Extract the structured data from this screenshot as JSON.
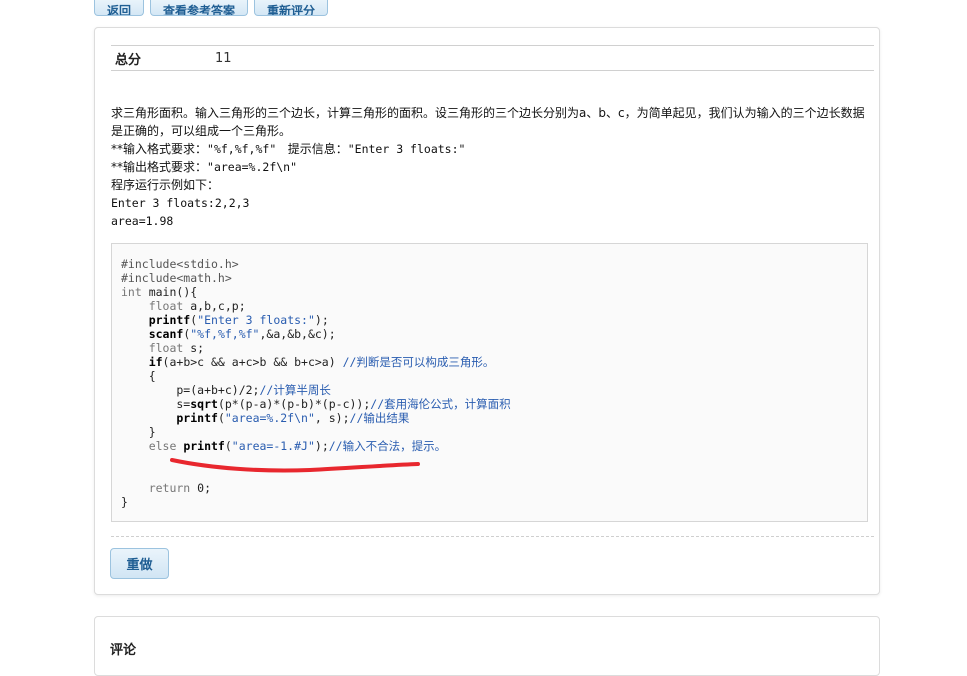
{
  "toolbar": {
    "back_label": "返回",
    "view_answer_label": "查看参考答案",
    "rescore_label": "重新评分"
  },
  "score": {
    "label": "总分",
    "value": "11"
  },
  "problem": {
    "line1": "求三角形面积。输入三角形的三个边长，计算三角形的面积。设三角形的三个边长分别为a、b、c，为简单起见，我们认为输入的三个边长数据是正确的，可以组成一个三角形。",
    "input_req_prefix": "**输入格式要求：",
    "input_req_format": "\"%f,%f,%f\"",
    "input_req_hint_label": "提示信息：",
    "input_req_hint": "\"Enter 3 floats:\"",
    "output_req_prefix": "**输出格式要求：",
    "output_req_format": "\"area=%.2f\\n\"",
    "example_label": "程序运行示例如下：",
    "example_input": "Enter 3 floats:2,2,3",
    "example_output": "area=1.98"
  },
  "code": {
    "l1": "#include<stdio.h>",
    "l2": "#include<math.h>",
    "l3a": "int",
    "l3b": " main(){",
    "l4a": "    float",
    "l4b": " a,b,c,p;",
    "l5a": "    printf",
    "l5b": "(",
    "l5c": "\"Enter 3 floats:\"",
    "l5d": ");",
    "l6a": "    scanf",
    "l6b": "(",
    "l6c": "\"%f,%f,%f\"",
    "l6d": ",&a,&b,&c);",
    "l7a": "    float",
    "l7b": " s;",
    "l8a": "    if",
    "l8b": "(a+b>c && a+c>b && b+c>a) ",
    "l8c": "//判断是否可以构成三角形。",
    "l9": "    {",
    "l10a": "        p=(a+b+c)/2;",
    "l10b": "//计算半周长",
    "l11a": "        s=",
    "l11b": "sqrt",
    "l11c": "(p*(p-a)*(p-b)*(p-c));",
    "l11d": "//套用海伦公式，计算面积",
    "l12a": "        printf",
    "l12b": "(",
    "l12c": "\"area=%.2f\\n\"",
    "l12d": ", s);",
    "l12e": "//输出结果",
    "l13": "    }",
    "l14a": "    else ",
    "l14b": "printf",
    "l14c": "(",
    "l14d": "\"area=-1.#J\"",
    "l14e": ");",
    "l14f": "//输入不合法，提示。",
    "l15": "",
    "l16": "",
    "l17a": "    return",
    "l17b": " 0;",
    "l18": "}"
  },
  "redo_label": "重做",
  "comments": {
    "title": "评论"
  },
  "colors": {
    "accent": "#1f5e93",
    "annotation": "#e8272e"
  }
}
